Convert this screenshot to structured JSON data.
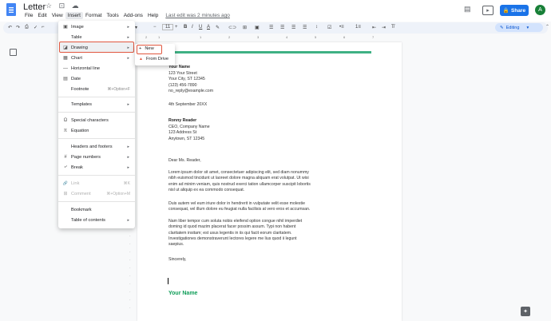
{
  "header": {
    "title": "Letter",
    "title_icons": "☆ ⊡ ☁",
    "menus": [
      "File",
      "Edit",
      "View",
      "Insert",
      "Format",
      "Tools",
      "Add-ons",
      "Help"
    ],
    "last_edit": "Last edit was 2 minutes ago",
    "share_label": "Share",
    "avatar_letter": "A",
    "comment_icon": "comment-icon",
    "present_icon": "present-icon"
  },
  "toolbar": {
    "font_size": "11",
    "minus": "−",
    "plus": "+",
    "bold": "B",
    "italic": "I",
    "underline": "U",
    "color": "A",
    "editing_label": "Editing"
  },
  "ruler": {
    "marks": [
      "2",
      "1",
      "1",
      "2",
      "3",
      "4",
      "5",
      "6",
      "7"
    ]
  },
  "insert_menu": {
    "items": [
      {
        "label": "Image",
        "icon": "▣",
        "arrow": "▸"
      },
      {
        "label": "Table",
        "icon": "",
        "arrow": "▸"
      },
      {
        "label": "Drawing",
        "icon": "◪",
        "arrow": "▸"
      },
      {
        "label": "Chart",
        "icon": "▦",
        "arrow": "▸"
      },
      {
        "label": "Horizontal line",
        "icon": "—",
        "arrow": ""
      },
      {
        "label": "Date",
        "icon": "▤",
        "arrow": ""
      },
      {
        "label": "Footnote",
        "icon": "",
        "shortcut": "⌘+Option+F"
      },
      {
        "label": "Templates",
        "icon": "",
        "arrow": "▸"
      },
      {
        "label": "Special characters",
        "icon": "Ω",
        "arrow": ""
      },
      {
        "label": "Equation",
        "icon": "π",
        "arrow": ""
      },
      {
        "label": "Headers and footers",
        "icon": "",
        "arrow": "▸"
      },
      {
        "label": "Page numbers",
        "icon": "#",
        "arrow": "▸"
      },
      {
        "label": "Break",
        "icon": "⤶",
        "arrow": "▸"
      },
      {
        "label": "Link",
        "icon": "🔗",
        "shortcut": "⌘K"
      },
      {
        "label": "Comment",
        "icon": "⊞",
        "shortcut": "⌘+Option+M"
      },
      {
        "label": "Bookmark",
        "icon": "",
        "arrow": ""
      },
      {
        "label": "Table of contents",
        "icon": "",
        "arrow": "▸"
      }
    ]
  },
  "drawing_submenu": {
    "new_label": "New",
    "new_icon": "+",
    "from_drive_label": "From Drive",
    "from_drive_icon": "▲"
  },
  "letter": {
    "sender_name": "Your Name",
    "sender_lines": [
      "123 Your Street",
      "Your City, ST 12345",
      "(123) 456-7890",
      "no_reply@example.com"
    ],
    "date": "4th September 20XX",
    "recipient_name": "Ronny Reader",
    "recipient_lines": [
      "CEO, Company Name",
      "123 Address St",
      "Anytown, ST 12345"
    ],
    "salutation": "Dear Ms. Reader,",
    "paragraph1": [
      "Lorem ipsum dolor sit amet, consectetuer adipiscing elit, sed diam nonummy",
      "nibh euismod tincidunt ut laoreet dolore magna aliquam erat volutpat. Ut wisi",
      "enim ad minim veniam, quis nostrud exerci tation ullamcorper suscipit lobortis",
      "nisl ut aliquip ex ea commodo consequat."
    ],
    "paragraph2": [
      "Duis autem vel eum iriure dolor in hendrerit in vulputate velit esse molestie",
      "consequat, vel illum dolore eu feugiat nulla facilisis at vero eros et accumsan."
    ],
    "paragraph3": [
      "Nam liber tempor cum soluta nobis eleifend option congue nihil imperdiet",
      "doming id quod mazim placerat facer possim assum. Typi non habent",
      "claritatem insitam; est usus legentis in iis qui facit eorum claritatem.",
      "Investigationes demonstraverunt lectores legere me lius quod ii legunt",
      "saepius."
    ],
    "closing": "Sincerely,",
    "signature": "Your Name"
  }
}
